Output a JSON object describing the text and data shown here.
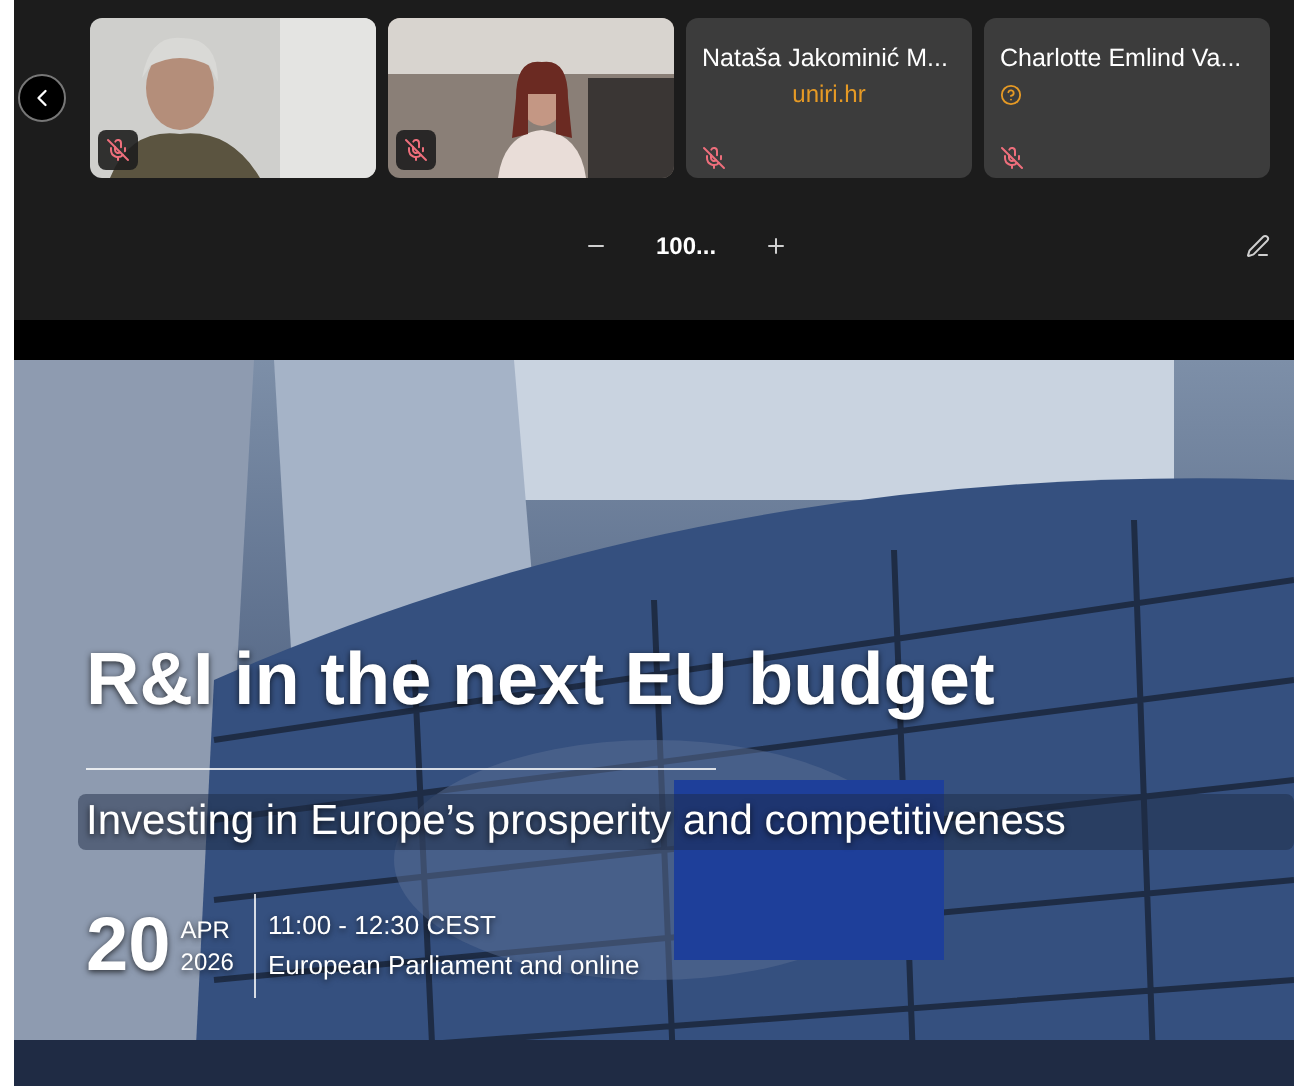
{
  "participants": [
    {
      "kind": "video",
      "muted": true
    },
    {
      "kind": "video",
      "muted": true
    },
    {
      "kind": "name",
      "name": "Nataša Jakominić M...",
      "org": "uniri.hr",
      "muted": true
    },
    {
      "kind": "name",
      "name": "Charlotte Emlind Va...",
      "unknown_org": true,
      "muted": true
    }
  ],
  "zoom": {
    "value": "100..."
  },
  "slide": {
    "title": "R&I in the next EU budget",
    "subtitle": "Investing in Europe’s prosperity and competitiveness",
    "day": "20",
    "month": "APR",
    "year": "2026",
    "time": "11:00 - 12:30 CEST",
    "location": "European Parliament and online"
  }
}
